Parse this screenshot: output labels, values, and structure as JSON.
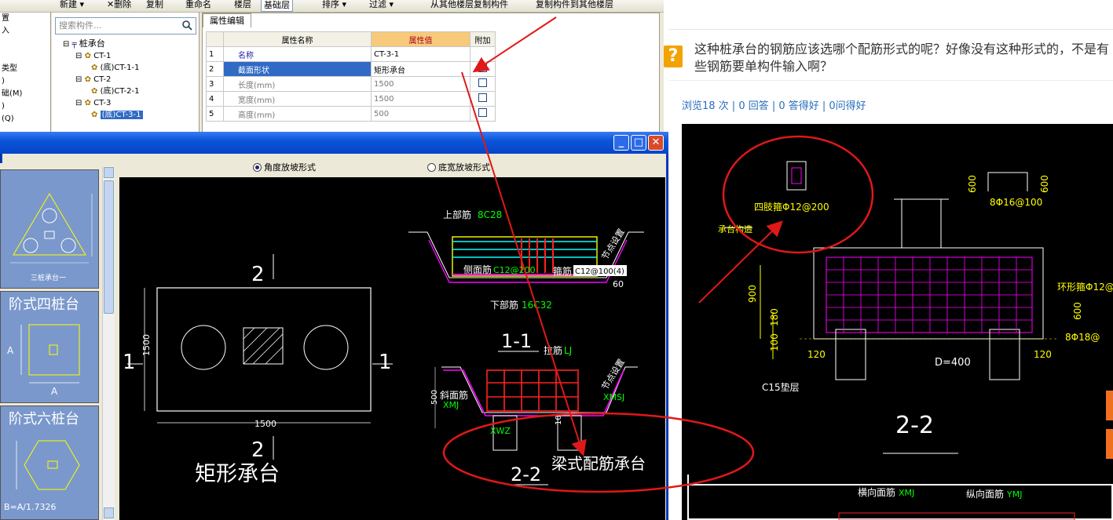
{
  "toolbar": {
    "new_label": "新建 ▾",
    "delete_label": "删除",
    "copy_label": "复制",
    "rename_label": "重命名",
    "floor_label": "楼层",
    "floor_value": "基础层",
    "sort_label": "排序 ▾",
    "filter_label": "过滤 ▾",
    "copy_from_label": "从其他楼层复制构件",
    "copy_to_label": "复制构件到其他楼层"
  },
  "left_strip": [
    "置",
    "入",
    "",
    "",
    "类型",
    ")",
    "础(M)",
    ")",
    "(Q)"
  ],
  "tree": {
    "search_placeholder": "搜索构件...",
    "root": "桩承台",
    "items": [
      {
        "label": "CT-1",
        "child": "(底)CT-1-1"
      },
      {
        "label": "CT-2",
        "child": "(底)CT-2-1"
      },
      {
        "label": "CT-3",
        "child": "(底)CT-3-1"
      }
    ]
  },
  "props": {
    "tab": "属性编辑",
    "col_name": "属性名称",
    "col_value": "属性值",
    "col_extra": "附加",
    "rows": [
      {
        "no": "1",
        "name": "名称",
        "value": "CT-3-1"
      },
      {
        "no": "2",
        "name": "截面形状",
        "value": "矩形承台"
      },
      {
        "no": "3",
        "name": "长度(mm)",
        "value": "1500"
      },
      {
        "no": "4",
        "name": "宽度(mm)",
        "value": "1500"
      },
      {
        "no": "5",
        "name": "高度(mm)",
        "value": "500"
      }
    ]
  },
  "dialog": {
    "radio_1": "角度放坡形式",
    "radio_2": "底宽放坡形式",
    "thumbs": [
      {
        "title": "",
        "caption": "三桩承台一"
      },
      {
        "title": "阶式四桩台",
        "caption": "A"
      },
      {
        "title": "阶式六桩台",
        "caption": "B=A/1.7326"
      }
    ]
  },
  "cad": {
    "plan_dim_w": "1500",
    "plan_dim_h": "1500",
    "section_mark": "2",
    "cut_mark": "1",
    "shape_title": "矩形承台",
    "top_bar": "上部筋",
    "top_bar_value": "8C28",
    "side_bar": "侧面筋",
    "side_bar_value": "C12@200",
    "stirrup": "箍筋",
    "stirrup_value": "C12@100(4)",
    "bottom_bar": "下部筋",
    "bottom_bar_value": "16C32",
    "node_note": "节点设置",
    "sec_1": "1-1",
    "tie_bar": "拉筋",
    "tie_bar_value": "LJ",
    "slope_bar": "斜面筋",
    "xmj": "XMJ",
    "xmsj": "XMSJ",
    "xwz": "XWZ",
    "sec_2": "2-2",
    "beam_caption": "梁式配筋承台",
    "dim_500": "500",
    "dim_60": "60",
    "dim_10": "10"
  },
  "question": {
    "text": "这种桩承台的钢筋应该选哪个配筋形式的呢？好像没有这种形式的，不是有些钢筋要单构件输入啊？",
    "stats": "浏览18 次 | 0 回答 | 0 答得好 | 0问得好"
  },
  "drawing2": {
    "ring_bar": "四肢箍Φ12@200",
    "support": "承台构造",
    "top_rebar": "8Φ16@100",
    "ring_right": "环形箍Φ12@2",
    "bot_rebar": "8Φ18@",
    "dim_900": "900",
    "dim_180": "180",
    "dim_100": "100",
    "dim_120a": "120",
    "dim_120b": "120",
    "dim_600a": "600",
    "dim_600b": "600",
    "dim_600c": "600",
    "d400": "D=400",
    "c15": "C15垫层",
    "section": "2-2",
    "hbar": "横向面筋",
    "hbar_code": "XMJ",
    "vbar": "纵向面筋",
    "vbar_code": "YMJ"
  },
  "colors": {
    "annotation_red": "#e01818",
    "cad_bg": "#000000",
    "xp_blue": "#0a55d8"
  }
}
